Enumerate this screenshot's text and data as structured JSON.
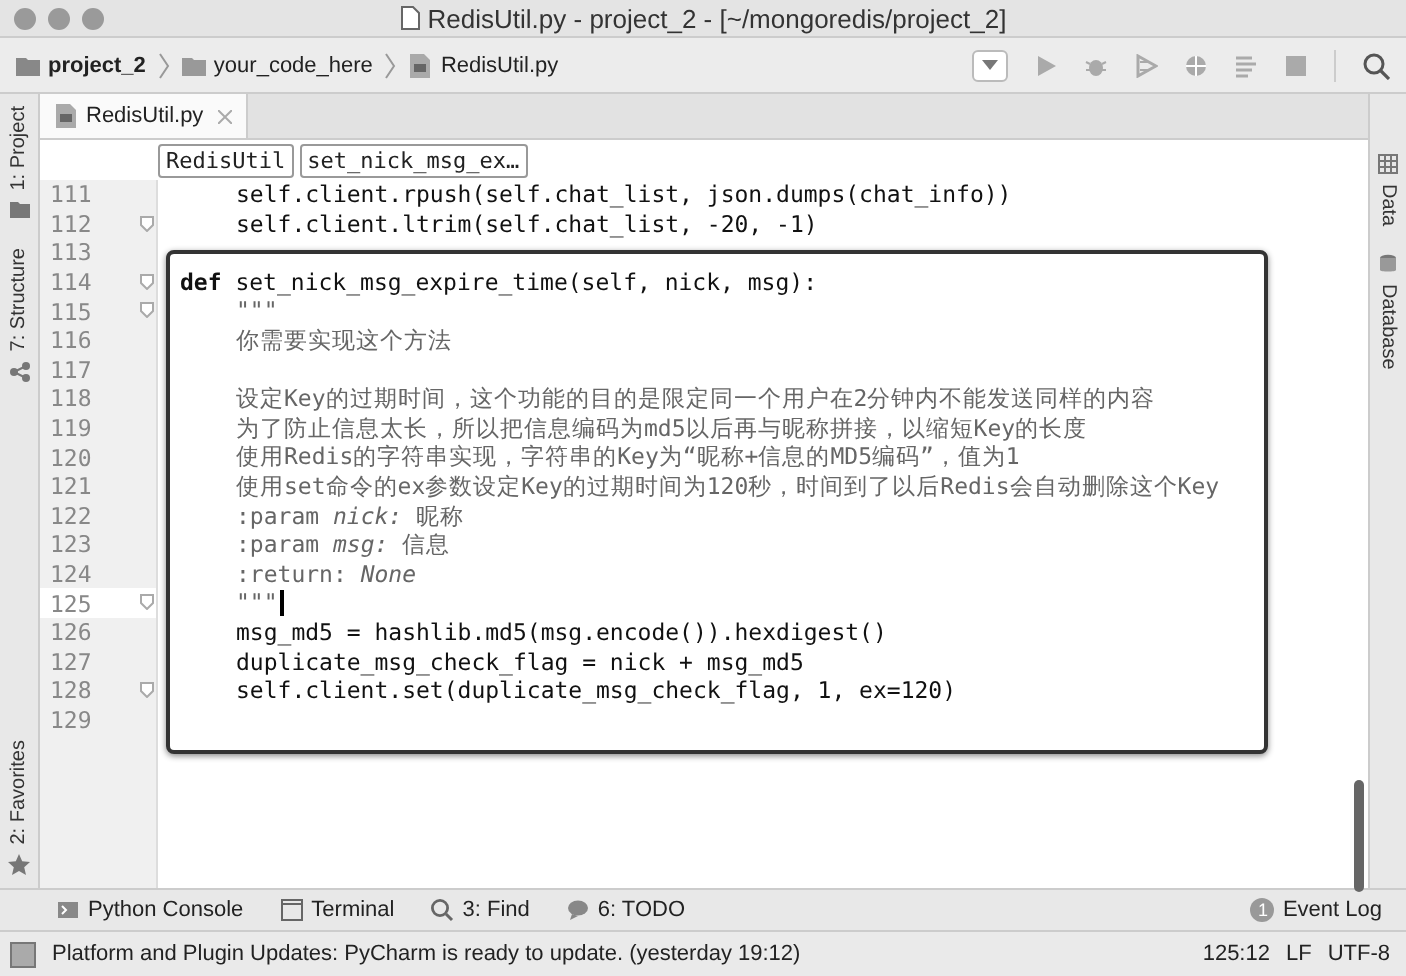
{
  "window": {
    "title": "RedisUtil.py - project_2 - [~/mongoredis/project_2]"
  },
  "navigation_bar": {
    "breadcrumbs": [
      {
        "label": "project_2",
        "kind": "project"
      },
      {
        "label": "your_code_here",
        "kind": "folder"
      },
      {
        "label": "RedisUtil.py",
        "kind": "file"
      }
    ]
  },
  "editor_tabs": [
    {
      "label": "RedisUtil.py",
      "selected": true
    }
  ],
  "structure_path": [
    "RedisUtil",
    "set_nick_msg_ex…"
  ],
  "left_tool_windows": [
    {
      "label": "1: Project",
      "kind": "project"
    },
    {
      "label": "7: Structure",
      "kind": "structure"
    },
    {
      "label": "2: Favorites",
      "kind": "favorites"
    }
  ],
  "right_tool_windows": [
    {
      "label": "Data",
      "kind": "data"
    },
    {
      "label": "Database",
      "kind": "database"
    }
  ],
  "code_lines": [
    {
      "number": "111",
      "kind": "code",
      "indented": true,
      "text": "self.client.rpush(self.chat_list, json.dumps(chat_info))"
    },
    {
      "number": "112",
      "kind": "code",
      "indented": true,
      "fold_marker": true,
      "text": "self.client.ltrim(self.chat_list, -20, -1)"
    },
    {
      "number": "113"
    }
  ],
  "popup": {
    "lines": [
      {
        "number": "114",
        "kind": "code",
        "fold_marker": true,
        "text": "**def** set_nick_msg_expire_time(self, nick, msg):"
      },
      {
        "number": "115",
        "kind": "doc",
        "indented": true,
        "fold_marker": true,
        "text": "\"\"\""
      },
      {
        "number": "116",
        "kind": "doc",
        "indented": true,
        "text": "你需要实现这个方法"
      },
      {
        "number": "117"
      },
      {
        "number": "118",
        "kind": "doc",
        "indented": true,
        "text": "设定Key的过期时间，这个功能的目的是限定同一个用户在2分钟内不能发送同样的内容"
      },
      {
        "number": "119",
        "kind": "doc",
        "indented": true,
        "text": "为了防止信息太长，所以把信息编码为md5以后再与昵称拼接，以缩短Key的长度"
      },
      {
        "number": "120",
        "kind": "doc",
        "indented": true,
        "text": "使用Redis的字符串实现，字符串的Key为“昵称+信息的MD5编码”，值为1"
      },
      {
        "number": "121",
        "kind": "doc",
        "indented": true,
        "text": "使用set命令的ex参数设定Key的过期时间为120秒，时间到了以后Redis会自动删除这个Key"
      },
      {
        "number": "122",
        "kind": "doc",
        "indented": true,
        "text": ":param *nick:* 昵称"
      },
      {
        "number": "123",
        "kind": "doc",
        "indented": true,
        "text": ":param *msg:* 信息"
      },
      {
        "number": "124",
        "kind": "doc",
        "indented": true,
        "text": ":return: *None*"
      },
      {
        "number": "125",
        "kind": "doc",
        "indented": true,
        "fold_marker": true,
        "current": true,
        "text": "\"\"\""
      },
      {
        "number": "126",
        "kind": "code",
        "indented": true,
        "text": "msg_md5 = hashlib.md5(msg.encode()).hexdigest()"
      },
      {
        "number": "127",
        "kind": "code",
        "indented": true,
        "text": "duplicate_msg_check_flag = nick + msg_md5"
      },
      {
        "number": "128",
        "kind": "code",
        "indented": true,
        "fold_marker": true,
        "text": "self.client.set(duplicate_msg_check_flag, 1, ex=120)"
      },
      {
        "number": "129"
      }
    ]
  },
  "bottom_tool_windows": [
    {
      "label": "Python Console",
      "kind": "console"
    },
    {
      "label": "Terminal",
      "kind": "terminal"
    },
    {
      "label": "3: Find",
      "kind": "find"
    },
    {
      "label": "6: TODO",
      "kind": "todo"
    }
  ],
  "event_log": {
    "count": "1",
    "label": "Event Log"
  },
  "status_bar": {
    "message": "Platform and Plugin Updates: PyCharm is ready to update. (yesterday 19:12)",
    "position": "125:12",
    "line_separator": "LF",
    "encoding": "UTF-8"
  }
}
